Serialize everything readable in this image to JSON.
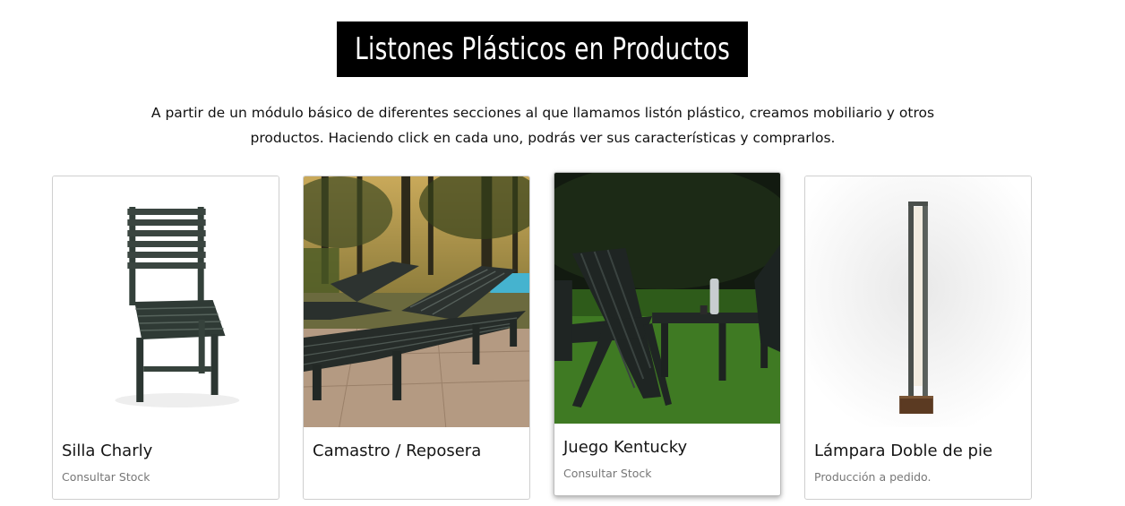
{
  "section": {
    "title": "Listones Plásticos en Productos",
    "intro_line1": "A partir de un módulo básico de diferentes secciones al que llamamos listón plástico, creamos mobiliario y otros",
    "intro_line2": "productos. Haciendo click en cada uno, podrás ver sus características y comprarlos."
  },
  "products": [
    {
      "name": "Silla Charly",
      "stock": "Consultar Stock",
      "image": "chair-photo"
    },
    {
      "name": "Camastro / Reposera",
      "stock": "",
      "image": "lounger-photo"
    },
    {
      "name": "Juego Kentucky",
      "stock": "Consultar Stock",
      "image": "kentucky-set-photo"
    },
    {
      "name": "Lámpara Doble de pie",
      "stock": "Producción a pedido.",
      "image": "floor-lamp-photo"
    }
  ],
  "colors": {
    "title_bg": "#000000",
    "title_text": "#ffffff",
    "muted": "#777777",
    "card_border": "#cfcfcf"
  }
}
